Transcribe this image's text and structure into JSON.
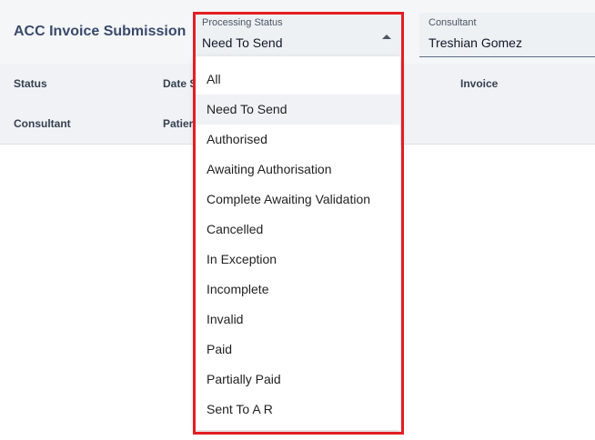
{
  "page": {
    "title": "ACC Invoice Submission"
  },
  "filters": {
    "processing_status": {
      "label": "Processing Status",
      "value": "Need To Send"
    },
    "consultant": {
      "label": "Consultant",
      "value": "Treshian Gomez"
    }
  },
  "columns": {
    "status": "Status",
    "date": "Date S",
    "invoice": "Invoice",
    "consultant": "Consultant",
    "patient": "Patier"
  },
  "dropdown": {
    "selected_index": 1,
    "options": [
      "All",
      "Need To Send",
      "Authorised",
      "Awaiting Authorisation",
      "Complete Awaiting Validation",
      "Cancelled",
      "In Exception",
      "Incomplete",
      "Invalid",
      "Paid",
      "Partially Paid",
      "Sent To A R"
    ]
  },
  "colors": {
    "highlight": "#e31e24",
    "title": "#3a4a6b",
    "selected_bg": "#f0f2f5"
  }
}
